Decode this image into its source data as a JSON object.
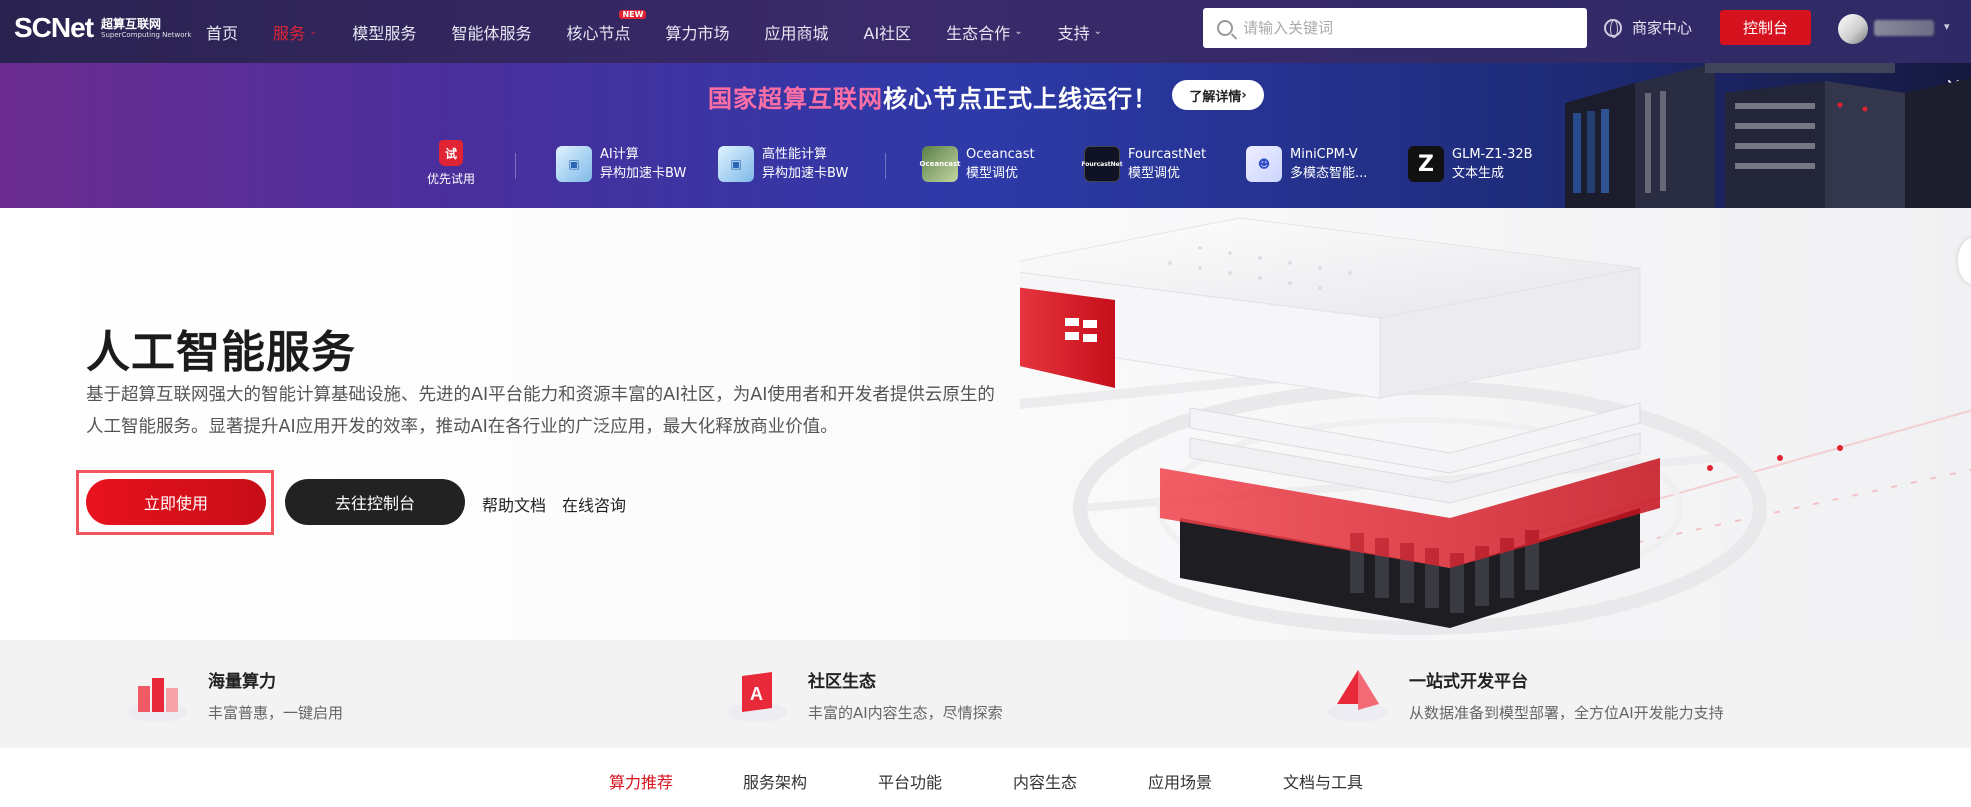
{
  "brand": {
    "logo_text": "SCNet",
    "sub_cn": "超算互联网",
    "sub_en": "SuperComputing Network"
  },
  "nav": {
    "items": [
      {
        "label": "首页",
        "caret": false
      },
      {
        "label": "服务",
        "caret": true,
        "active": true
      },
      {
        "label": "模型服务",
        "caret": false
      },
      {
        "label": "智能体服务",
        "caret": false
      },
      {
        "label": "核心节点",
        "caret": false,
        "badge": "NEW"
      },
      {
        "label": "算力市场",
        "caret": false
      },
      {
        "label": "应用商城",
        "caret": false
      },
      {
        "label": "AI社区",
        "caret": false
      },
      {
        "label": "生态合作",
        "caret": true
      },
      {
        "label": "支持",
        "caret": true
      }
    ],
    "search_placeholder": "请输入关键词",
    "merchant_label": "商家中心",
    "console_label": "控制台"
  },
  "promo": {
    "title_pink": "国家超算互联网",
    "title_white": "核心节点正式上线运行！",
    "learn_more": "了解详情",
    "close_symbol": "×",
    "trial": {
      "badge": "试",
      "label": "优先试用"
    },
    "items": [
      {
        "icon": "ai-compute-icon",
        "line1": "AI计算",
        "line2": "异构加速卡BW"
      },
      {
        "icon": "hpc-icon",
        "line1": "高性能计算",
        "line2": "异构加速卡BW"
      },
      {
        "icon": "oceancast-icon",
        "icon_text": "Oceancast",
        "line1": "Oceancast",
        "line2": "模型调优"
      },
      {
        "icon": "fourcastnet-icon",
        "icon_text": "FourcastNet",
        "line1": "FourcastNet",
        "line2": "模型调优"
      },
      {
        "icon": "minicpm-icon",
        "line1": "MiniCPM-V",
        "line2": "多模态智能..."
      },
      {
        "icon": "glm-icon",
        "icon_text": "Z",
        "line1": "GLM-Z1-32B",
        "line2": "文本生成"
      }
    ]
  },
  "hero": {
    "title": "人工智能服务",
    "description": "基于超算互联网强大的智能计算基础设施、先进的AI平台能力和资源丰富的AI社区，为AI使用者和开发者提供云原生的人工智能服务。显著提升AI应用开发的效率，推动AI在各行业的广泛应用，最大化释放商业价值。",
    "primary_button": "立即使用",
    "secondary_button": "去往控制台",
    "help_link": "帮助文档",
    "consult_link": "在线咨询"
  },
  "features": [
    {
      "icon": "compute-icon",
      "title": "海量算力",
      "desc": "丰富普惠，一键启用"
    },
    {
      "icon": "community-icon",
      "title": "社区生态",
      "desc": "丰富的AI内容生态，尽情探索"
    },
    {
      "icon": "platform-icon",
      "title": "一站式开发平台",
      "desc": "从数据准备到模型部署，全方位AI开发能力支持"
    }
  ],
  "tabs": [
    {
      "label": "算力推荐",
      "active": true
    },
    {
      "label": "服务架构"
    },
    {
      "label": "平台功能"
    },
    {
      "label": "内容生态"
    },
    {
      "label": "应用场景"
    },
    {
      "label": "文档与工具"
    }
  ],
  "colors": {
    "accent": "#d6121f",
    "nav_bg": "#2a2350",
    "dark_button": "#222222"
  }
}
